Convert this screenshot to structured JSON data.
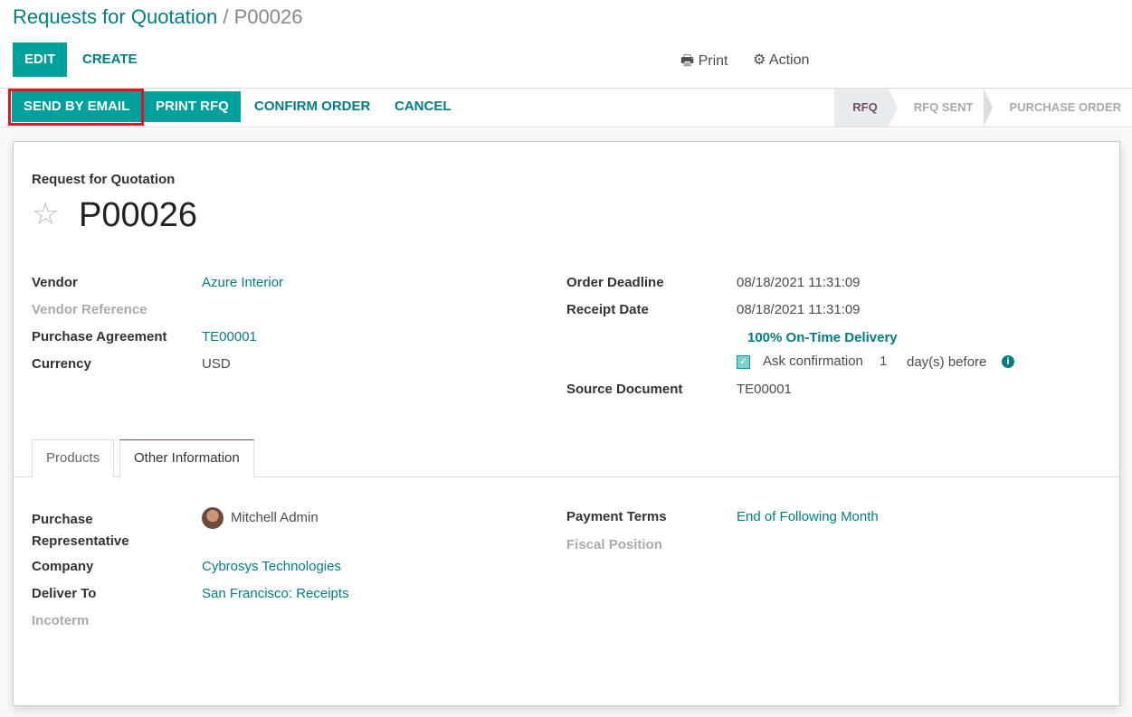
{
  "breadcrumb": {
    "parent": "Requests for Quotation",
    "separator": "/",
    "current": "P00026"
  },
  "control": {
    "edit": "EDIT",
    "create": "CREATE",
    "print": "Print",
    "action": "Action"
  },
  "status_buttons": {
    "send_email": "SEND BY EMAIL",
    "print_rfq": "PRINT RFQ",
    "confirm": "CONFIRM ORDER",
    "cancel": "CANCEL"
  },
  "stages": [
    {
      "label": "RFQ",
      "active": true
    },
    {
      "label": "RFQ SENT",
      "active": false
    },
    {
      "label": "PURCHASE ORDER",
      "active": false
    }
  ],
  "form": {
    "subtitle": "Request for Quotation",
    "name": "P00026",
    "left": [
      {
        "label": "Vendor",
        "value": "Azure Interior"
      },
      {
        "label": "Vendor Reference",
        "value": ""
      },
      {
        "label": "Purchase Agreement",
        "value": "TE00001"
      },
      {
        "label": "Currency",
        "value": "USD"
      }
    ],
    "right": {
      "order_deadline_label": "Order Deadline",
      "order_deadline": "08/18/2021 11:31:09",
      "receipt_date_label": "Receipt Date",
      "receipt_date": "08/18/2021 11:31:09",
      "on_time": "100% On-Time Delivery",
      "ask_confirmation": "Ask confirmation",
      "ask_days": "1",
      "ask_suffix": "day(s) before",
      "ask_checked": true,
      "source_label": "Source Document",
      "source": "TE00001"
    }
  },
  "tabs": [
    {
      "label": "Products"
    },
    {
      "label": "Other Information",
      "active": true
    }
  ],
  "other": {
    "rep_label_1": "Purchase",
    "rep_label_2": "Representative",
    "rep": "Mitchell Admin",
    "company_label": "Company",
    "company": "Cybrosys Technologies",
    "deliver_label": "Deliver To",
    "deliver": "San Francisco: Receipts",
    "incoterm_label": "Incoterm",
    "payment_label": "Payment Terms",
    "payment": "End of Following Month",
    "fiscal_label": "Fiscal Position"
  },
  "colors": {
    "primary": "#00a09d",
    "link": "#017e84",
    "stage_active": "#714b67",
    "highlight": "#e5141e"
  }
}
